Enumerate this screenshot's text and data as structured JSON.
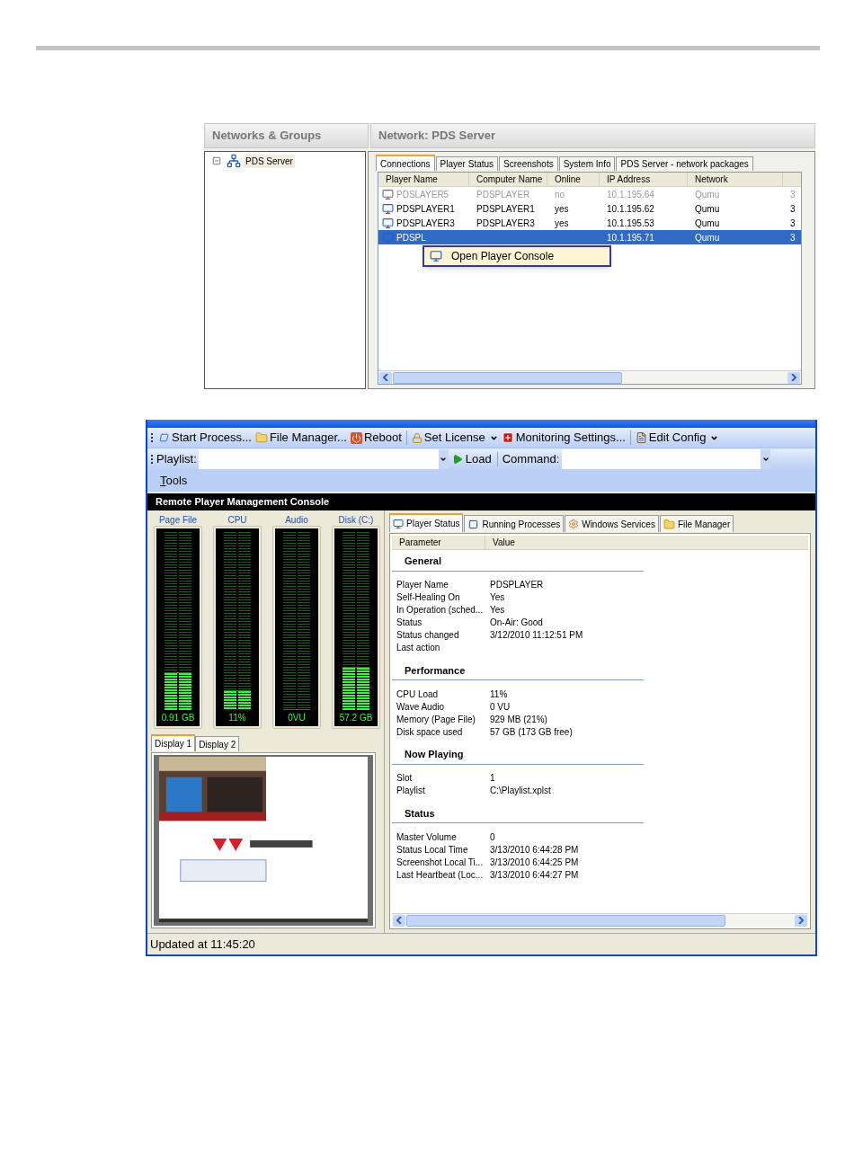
{
  "network_window": {
    "panes": [
      {
        "title": "Networks & Groups"
      },
      {
        "title": "Network: PDS Server"
      }
    ],
    "tree": [
      {
        "label": "PDS Server",
        "expanded": true,
        "selected": true
      }
    ],
    "tabs": [
      {
        "label": "Connections",
        "selected": true
      },
      {
        "label": "Player Status",
        "selected": false
      },
      {
        "label": "Screenshots",
        "selected": false
      },
      {
        "label": "System Info",
        "selected": false
      },
      {
        "label": "PDS Server - network packages",
        "selected": false
      }
    ],
    "table": {
      "columns": [
        "Player Name",
        "Computer Name",
        "Online",
        "IP Address",
        "Network"
      ],
      "rows": [
        {
          "cells": [
            "PDSLAYER5",
            "PDSPLAYER",
            "no",
            "10.1.195.64",
            "Qumu",
            "3"
          ],
          "online": false,
          "selected": false
        },
        {
          "cells": [
            "PDSPLAYER1",
            "PDSPLAYER1",
            "yes",
            "10.1.195.62",
            "Qumu",
            "3"
          ],
          "online": true,
          "selected": false
        },
        {
          "cells": [
            "PDSPLAYER3",
            "PDSPLAYER3",
            "yes",
            "10.1.195.53",
            "Qumu",
            "3"
          ],
          "online": true,
          "selected": false
        },
        {
          "cells": [
            "PDSPL",
            null,
            null,
            "10.1.195.71",
            "Qumu",
            "3"
          ],
          "online": true,
          "selected": true
        }
      ]
    },
    "context_menu": {
      "items": [
        {
          "label": "Open Player Console"
        }
      ]
    }
  },
  "console_window": {
    "toolbar": [
      {
        "label": "Start Process...",
        "has_menu": false
      },
      {
        "label": "File Manager...",
        "has_menu": false
      },
      {
        "label": "Reboot",
        "has_menu": false
      },
      {
        "label": "Set License",
        "has_menu": true
      },
      {
        "label": "Monitoring Settings...",
        "has_menu": false
      },
      {
        "label": "Edit Config",
        "has_menu": true
      }
    ],
    "playlist": {
      "label": "Playlist:"
    },
    "load_button": "Load",
    "command": {
      "label": "Command:"
    },
    "menu": [
      "Tools"
    ],
    "title": "Remote Player Management Console",
    "meters": [
      {
        "label": "Page File",
        "level": 0.21,
        "reading": "0.91 GB"
      },
      {
        "label": "CPU",
        "level": 0.11,
        "reading": "11%"
      },
      {
        "label": "Audio",
        "level": 0,
        "reading": "0VU"
      },
      {
        "label": "Disk (C:)",
        "level": 0.24,
        "reading": "57.2 GB"
      }
    ],
    "display_tabs": [
      {
        "label": "Display 1",
        "selected": true
      },
      {
        "label": "Display 2",
        "selected": false
      }
    ],
    "display_preview": {
      "kind": "picture"
    },
    "tabs": [
      {
        "label": "Player Status",
        "selected": true
      },
      {
        "label": "Running Processes",
        "selected": false
      },
      {
        "label": "Windows Services",
        "selected": false
      },
      {
        "label": "File Manager",
        "selected": false
      }
    ],
    "properties": {
      "columns": [
        "Parameter",
        "Value"
      ],
      "sections": [
        {
          "title": "General",
          "rows": [
            {
              "name": "Player Name",
              "value": "PDSPLAYER"
            },
            {
              "name": "Self-Healing On",
              "value": "Yes"
            },
            {
              "name": "In Operation (sched...",
              "value": "Yes"
            },
            {
              "name": "Status",
              "value": "On-Air: Good"
            },
            {
              "name": "Status changed",
              "value": "3/12/2010 11:12:51 PM"
            },
            {
              "name": "Last action"
            }
          ]
        },
        {
          "title": "Performance",
          "rows": [
            {
              "name": "CPU Load",
              "value": "11%"
            },
            {
              "name": "Wave Audio",
              "value": "0 VU"
            },
            {
              "name": "Memory (Page File)",
              "value": "929 MB (21%)"
            },
            {
              "name": "Disk space used",
              "value": "57 GB (173 GB free)"
            }
          ]
        },
        {
          "title": "Now Playing",
          "rows": [
            {
              "name": "Slot",
              "value": "1"
            },
            {
              "name": "Playlist",
              "value": "C:\\Playlist.xplst"
            }
          ]
        },
        {
          "title": "Status",
          "rows": [
            {
              "name": "Master Volume",
              "value": "0"
            },
            {
              "name": "Status Local Time",
              "value": "3/13/2010 6:44:28 PM"
            },
            {
              "name": "Screenshot Local Ti...",
              "value": "3/13/2010 6:44:25 PM"
            },
            {
              "name": "Last Heartbeat (Loc...",
              "value": "3/13/2010 6:44:27 PM"
            }
          ]
        }
      ]
    },
    "status_bar": "Updated at 11:45:20"
  }
}
